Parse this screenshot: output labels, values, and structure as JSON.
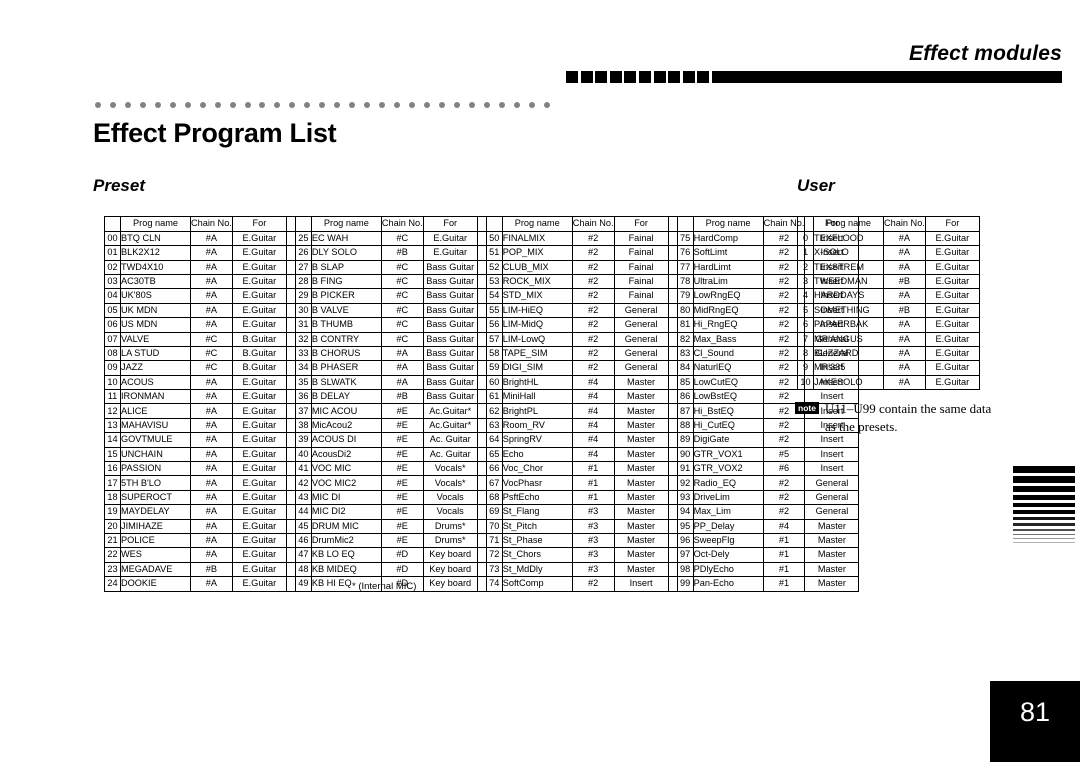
{
  "header": {
    "running_title": "Effect modules"
  },
  "page_title": "Effect Program List",
  "sections": {
    "preset_label": "Preset",
    "user_label": "User"
  },
  "table_headers": {
    "index": "",
    "prog_name": "Prog name",
    "chain_no": "Chain No.",
    "for": "For"
  },
  "footnote": "* (Internal MIC)",
  "note": {
    "badge": "note",
    "text": "U11–U99 contain the same data as the presets."
  },
  "page_number": "81",
  "colors": {
    "ink": "#000000",
    "dot_rule": "#808285",
    "page_number_bg": "#000000",
    "page_number_fg": "#ffffff"
  },
  "preset_programs": [
    {
      "no": "00",
      "name": "BTQ CLN",
      "chain": "#A",
      "for": "E.Guitar"
    },
    {
      "no": "01",
      "name": "BLK2X12",
      "chain": "#A",
      "for": "E.Guitar"
    },
    {
      "no": "02",
      "name": "TWD4X10",
      "chain": "#A",
      "for": "E.Guitar"
    },
    {
      "no": "03",
      "name": "AC30TB",
      "chain": "#A",
      "for": "E.Guitar"
    },
    {
      "no": "04",
      "name": "UK'80S",
      "chain": "#A",
      "for": "E.Guitar"
    },
    {
      "no": "05",
      "name": "UK MDN",
      "chain": "#A",
      "for": "E.Guitar"
    },
    {
      "no": "06",
      "name": "US MDN",
      "chain": "#A",
      "for": "E.Guitar"
    },
    {
      "no": "07",
      "name": "VALVE",
      "chain": "#C",
      "for": "B.Guitar"
    },
    {
      "no": "08",
      "name": "LA STUD",
      "chain": "#C",
      "for": "B.Guitar"
    },
    {
      "no": "09",
      "name": "JAZZ",
      "chain": "#C",
      "for": "B.Guitar"
    },
    {
      "no": "10",
      "name": "ACOUS",
      "chain": "#A",
      "for": "E.Guitar"
    },
    {
      "no": "11",
      "name": "IRONMAN",
      "chain": "#A",
      "for": "E.Guitar"
    },
    {
      "no": "12",
      "name": "ALICE",
      "chain": "#A",
      "for": "E.Guitar"
    },
    {
      "no": "13",
      "name": "MAHAVISU",
      "chain": "#A",
      "for": "E.Guitar"
    },
    {
      "no": "14",
      "name": "GOVTMULE",
      "chain": "#A",
      "for": "E.Guitar"
    },
    {
      "no": "15",
      "name": "UNCHAIN",
      "chain": "#A",
      "for": "E.Guitar"
    },
    {
      "no": "16",
      "name": "PASSION",
      "chain": "#A",
      "for": "E.Guitar"
    },
    {
      "no": "17",
      "name": "5TH B'LO",
      "chain": "#A",
      "for": "E.Guitar"
    },
    {
      "no": "18",
      "name": "SUPEROCT",
      "chain": "#A",
      "for": "E.Guitar"
    },
    {
      "no": "19",
      "name": "MAYDELAY",
      "chain": "#A",
      "for": "E.Guitar"
    },
    {
      "no": "20",
      "name": "JIMIHAZE",
      "chain": "#A",
      "for": "E.Guitar"
    },
    {
      "no": "21",
      "name": "POLICE",
      "chain": "#A",
      "for": "E.Guitar"
    },
    {
      "no": "22",
      "name": "WES",
      "chain": "#A",
      "for": "E.Guitar"
    },
    {
      "no": "23",
      "name": "MEGADAVE",
      "chain": "#B",
      "for": "E.Guitar"
    },
    {
      "no": "24",
      "name": "DOOKIE",
      "chain": "#A",
      "for": "E.Guitar"
    },
    {
      "no": "25",
      "name": "EC WAH",
      "chain": "#C",
      "for": "E.Guitar"
    },
    {
      "no": "26",
      "name": "DLY SOLO",
      "chain": "#B",
      "for": "E.Guitar"
    },
    {
      "no": "27",
      "name": "B SLAP",
      "chain": "#C",
      "for": "Bass Guitar"
    },
    {
      "no": "28",
      "name": "B FING",
      "chain": "#C",
      "for": "Bass Guitar"
    },
    {
      "no": "29",
      "name": "B PICKER",
      "chain": "#C",
      "for": "Bass Guitar"
    },
    {
      "no": "30",
      "name": "B VALVE",
      "chain": "#C",
      "for": "Bass Guitar"
    },
    {
      "no": "31",
      "name": "B THUMB",
      "chain": "#C",
      "for": "Bass Guitar"
    },
    {
      "no": "32",
      "name": "B CONTRY",
      "chain": "#C",
      "for": "Bass Guitar"
    },
    {
      "no": "33",
      "name": "B CHORUS",
      "chain": "#A",
      "for": "Bass Guitar"
    },
    {
      "no": "34",
      "name": "B PHASER",
      "chain": "#A",
      "for": "Bass Guitar"
    },
    {
      "no": "35",
      "name": "B SLWATK",
      "chain": "#A",
      "for": "Bass Guitar"
    },
    {
      "no": "36",
      "name": "B DELAY",
      "chain": "#B",
      "for": "Bass Guitar"
    },
    {
      "no": "37",
      "name": "MIC ACOU",
      "chain": "#E",
      "for": "Ac.Guitar*"
    },
    {
      "no": "38",
      "name": "MicAcou2",
      "chain": "#E",
      "for": "Ac.Guitar*"
    },
    {
      "no": "39",
      "name": "ACOUS DI",
      "chain": "#E",
      "for": "Ac. Guitar"
    },
    {
      "no": "40",
      "name": "AcousDi2",
      "chain": "#E",
      "for": "Ac. Guitar"
    },
    {
      "no": "41",
      "name": "VOC  MIC",
      "chain": "#E",
      "for": "Vocals*"
    },
    {
      "no": "42",
      "name": "VOC  MIC2",
      "chain": "#E",
      "for": "Vocals*"
    },
    {
      "no": "43",
      "name": "MIC DI",
      "chain": "#E",
      "for": "Vocals"
    },
    {
      "no": "44",
      "name": "MIC DI2",
      "chain": "#E",
      "for": "Vocals"
    },
    {
      "no": "45",
      "name": "DRUM MIC",
      "chain": "#E",
      "for": "Drums*"
    },
    {
      "no": "46",
      "name": "DrumMic2",
      "chain": "#E",
      "for": "Drums*"
    },
    {
      "no": "47",
      "name": "KB LO EQ",
      "chain": "#D",
      "for": "Key board"
    },
    {
      "no": "48",
      "name": "KB MIDEQ",
      "chain": "#D",
      "for": "Key board"
    },
    {
      "no": "49",
      "name": "KB HI EQ",
      "chain": "#D",
      "for": "Key board"
    },
    {
      "no": "50",
      "name": "FINALMIX",
      "chain": "#2",
      "for": "Fainal"
    },
    {
      "no": "51",
      "name": "POP_MIX",
      "chain": "#2",
      "for": "Fainal"
    },
    {
      "no": "52",
      "name": "CLUB_MIX",
      "chain": "#2",
      "for": "Fainal"
    },
    {
      "no": "53",
      "name": "ROCK_MIX",
      "chain": "#2",
      "for": "Fainal"
    },
    {
      "no": "54",
      "name": "STD_MIX",
      "chain": "#2",
      "for": "Fainal"
    },
    {
      "no": "55",
      "name": "LIM-HiEQ",
      "chain": "#2",
      "for": "General"
    },
    {
      "no": "56",
      "name": "LIM-MidQ",
      "chain": "#2",
      "for": "General"
    },
    {
      "no": "57",
      "name": "LIM-LowQ",
      "chain": "#2",
      "for": "General"
    },
    {
      "no": "58",
      "name": "TAPE_SIM",
      "chain": "#2",
      "for": "General"
    },
    {
      "no": "59",
      "name": "DIGI_SIM",
      "chain": "#2",
      "for": "General"
    },
    {
      "no": "60",
      "name": "BrightHL",
      "chain": "#4",
      "for": "Master"
    },
    {
      "no": "61",
      "name": "MiniHall",
      "chain": "#4",
      "for": "Master"
    },
    {
      "no": "62",
      "name": "BrightPL",
      "chain": "#4",
      "for": "Master"
    },
    {
      "no": "63",
      "name": "Room_RV",
      "chain": "#4",
      "for": "Master"
    },
    {
      "no": "64",
      "name": "SpringRV",
      "chain": "#4",
      "for": "Master"
    },
    {
      "no": "65",
      "name": "Echo",
      "chain": "#4",
      "for": "Master"
    },
    {
      "no": "66",
      "name": "Voc_Chor",
      "chain": "#1",
      "for": "Master"
    },
    {
      "no": "67",
      "name": "VocPhasr",
      "chain": "#1",
      "for": "Master"
    },
    {
      "no": "68",
      "name": "PsftEcho",
      "chain": "#1",
      "for": "Master"
    },
    {
      "no": "69",
      "name": "St_Flang",
      "chain": "#3",
      "for": "Master"
    },
    {
      "no": "70",
      "name": "St_Pitch",
      "chain": "#3",
      "for": "Master"
    },
    {
      "no": "71",
      "name": "St_Phase",
      "chain": "#3",
      "for": "Master"
    },
    {
      "no": "72",
      "name": "St_Chors",
      "chain": "#3",
      "for": "Master"
    },
    {
      "no": "73",
      "name": "St_MdDly",
      "chain": "#3",
      "for": "Master"
    },
    {
      "no": "74",
      "name": "SoftComp",
      "chain": "#2",
      "for": "Insert"
    },
    {
      "no": "75",
      "name": "HardComp",
      "chain": "#2",
      "for": "Insert"
    },
    {
      "no": "76",
      "name": "SoftLimt",
      "chain": "#2",
      "for": "Insert"
    },
    {
      "no": "77",
      "name": "HardLimt",
      "chain": "#2",
      "for": "Insert"
    },
    {
      "no": "78",
      "name": "UltraLim",
      "chain": "#2",
      "for": "Insert"
    },
    {
      "no": "79",
      "name": "LowRngEQ",
      "chain": "#2",
      "for": "Insert"
    },
    {
      "no": "80",
      "name": "MidRngEQ",
      "chain": "#2",
      "for": "Insert"
    },
    {
      "no": "81",
      "name": "Hi_RngEQ",
      "chain": "#2",
      "for": "Insert"
    },
    {
      "no": "82",
      "name": "Max_Bass",
      "chain": "#2",
      "for": "General"
    },
    {
      "no": "83",
      "name": "Cl_Sound",
      "chain": "#2",
      "for": "General"
    },
    {
      "no": "84",
      "name": "NaturlEQ",
      "chain": "#2",
      "for": "Insert"
    },
    {
      "no": "85",
      "name": "LowCutEQ",
      "chain": "#2",
      "for": "Insert"
    },
    {
      "no": "86",
      "name": "LowBstEQ",
      "chain": "#2",
      "for": "Insert"
    },
    {
      "no": "87",
      "name": "Hi_BstEQ",
      "chain": "#2",
      "for": "Insert"
    },
    {
      "no": "88",
      "name": "Hi_CutEQ",
      "chain": "#2",
      "for": "Insert"
    },
    {
      "no": "89",
      "name": "DigiGate",
      "chain": "#2",
      "for": "Insert"
    },
    {
      "no": "90",
      "name": "GTR_VOX1",
      "chain": "#5",
      "for": "Insert"
    },
    {
      "no": "91",
      "name": "GTR_VOX2",
      "chain": "#6",
      "for": "Insert"
    },
    {
      "no": "92",
      "name": "Radio_EQ",
      "chain": "#2",
      "for": "General"
    },
    {
      "no": "93",
      "name": "DriveLim",
      "chain": "#2",
      "for": "General"
    },
    {
      "no": "94",
      "name": "Max_Lim",
      "chain": "#2",
      "for": "General"
    },
    {
      "no": "95",
      "name": "PP_Delay",
      "chain": "#4",
      "for": "Master"
    },
    {
      "no": "96",
      "name": "SweepFlg",
      "chain": "#1",
      "for": "Master"
    },
    {
      "no": "97",
      "name": "Oct-Dely",
      "chain": "#1",
      "for": "Master"
    },
    {
      "no": "98",
      "name": "PDlyEcho",
      "chain": "#1",
      "for": "Master"
    },
    {
      "no": "99",
      "name": "Pan-Echo",
      "chain": "#1",
      "for": "Master"
    }
  ],
  "user_programs": [
    {
      "no": "0",
      "name": "TEXFLOOD",
      "chain": "#A",
      "for": "E.Guitar"
    },
    {
      "no": "1",
      "name": "X-SOLO",
      "chain": "#A",
      "for": "E.Guitar"
    },
    {
      "no": "2",
      "name": "TEXSTREM",
      "chain": "#A",
      "for": "E.Guitar"
    },
    {
      "no": "3",
      "name": "TWEEDMAN",
      "chain": "#B",
      "for": "E.Guitar"
    },
    {
      "no": "4",
      "name": "HARDDAYS",
      "chain": "#A",
      "for": "E.Guitar"
    },
    {
      "no": "5",
      "name": "SOMETHING",
      "chain": "#B",
      "for": "E.Guitar"
    },
    {
      "no": "6",
      "name": "PAPAERBAK",
      "chain": "#A",
      "for": "E.Guitar"
    },
    {
      "no": "7",
      "name": "MR'ANGUS",
      "chain": "#A",
      "for": "E.Guitar"
    },
    {
      "no": "8",
      "name": "BLIZZARD",
      "chain": "#A",
      "for": "E.Guitar"
    },
    {
      "no": "9",
      "name": "MR'335",
      "chain": "#A",
      "for": "E.Guitar"
    },
    {
      "no": "10",
      "name": "JAKESOLO",
      "chain": "#A",
      "for": "E.Guitar"
    }
  ]
}
